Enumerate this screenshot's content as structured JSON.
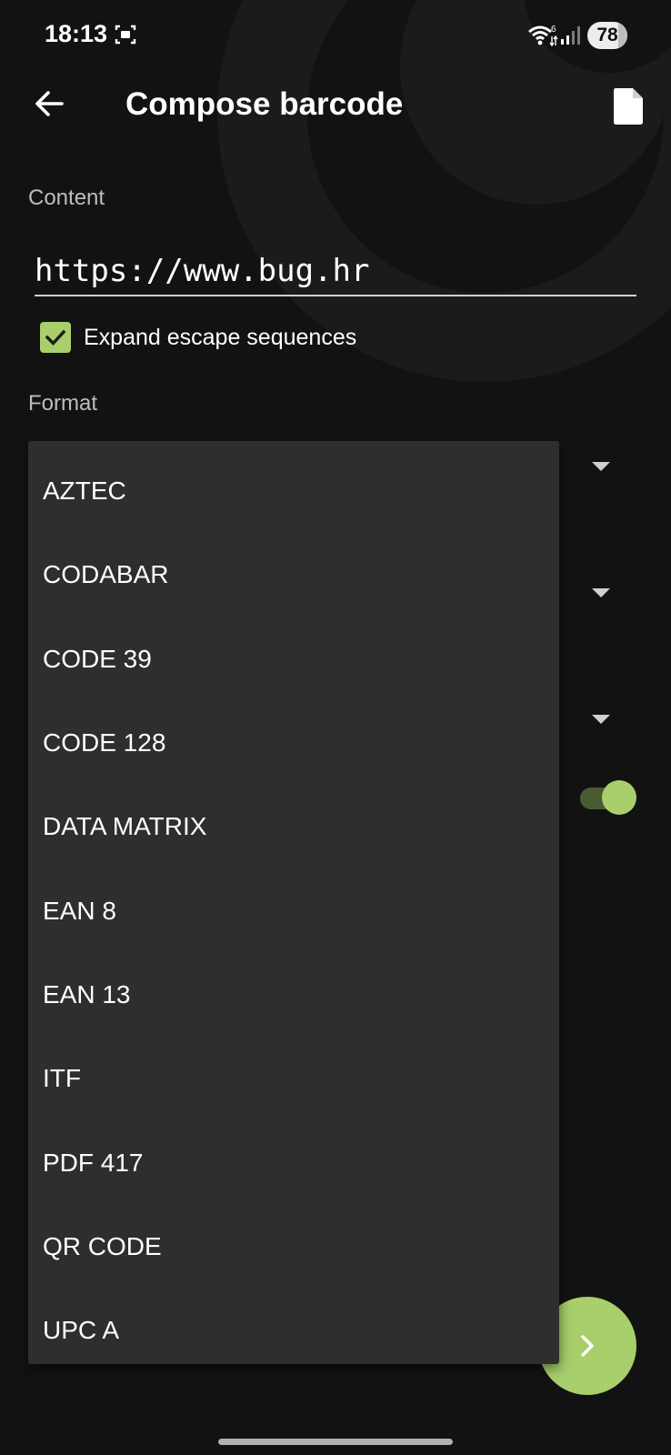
{
  "status_bar": {
    "time": "18:13",
    "battery": "78"
  },
  "app_bar": {
    "title": "Compose barcode"
  },
  "form": {
    "content_label": "Content",
    "content_value": "https://www.bug.hr",
    "expand_escape_label": "Expand escape sequences",
    "expand_escape_checked": true,
    "format_label": "Format"
  },
  "dropdown": {
    "options": [
      "AZTEC",
      "CODABAR",
      "CODE 39",
      "CODE 128",
      "DATA MATRIX",
      "EAN 8",
      "EAN 13",
      "ITF",
      "PDF 417",
      "QR CODE",
      "UPC A"
    ]
  },
  "colors": {
    "accent": "#a8cf6c",
    "background": "#121212",
    "menu_background": "#2e2e2e"
  },
  "icons": {
    "back": "arrow-left-icon",
    "file": "file-icon",
    "fab": "chevron-right-icon",
    "checkbox": "check-icon",
    "screenshot": "screenshot-icon",
    "wifi": "wifi-icon",
    "signal": "signal-icon"
  }
}
